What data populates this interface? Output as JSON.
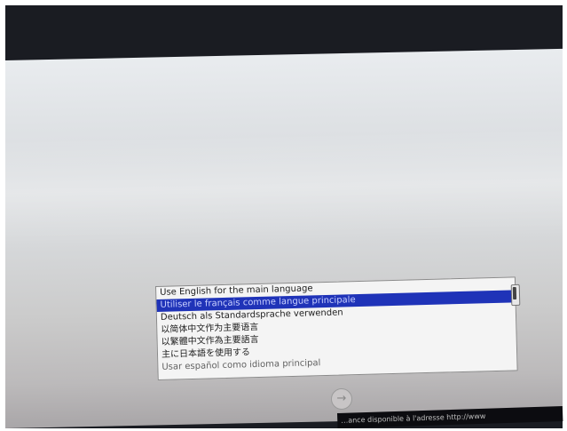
{
  "language_selection": {
    "options": [
      "Use English for the main language",
      "Utiliser le français comme langue principale",
      "Deutsch als Standardsprache verwenden",
      "以简体中文作为主要语言",
      "以繁體中文作為主要語言",
      "主に日本語を使用する",
      "Usar español como idioma principal"
    ],
    "selected_index": 1
  },
  "next_button": {
    "icon": "arrow-right-icon",
    "glyph": "→"
  },
  "footer": {
    "text": "…ance disponible à l'adresse http://www"
  },
  "colors": {
    "selection": "#1f33b8",
    "screen_background": "#d6d8da",
    "bezel": "#1a1c22"
  }
}
